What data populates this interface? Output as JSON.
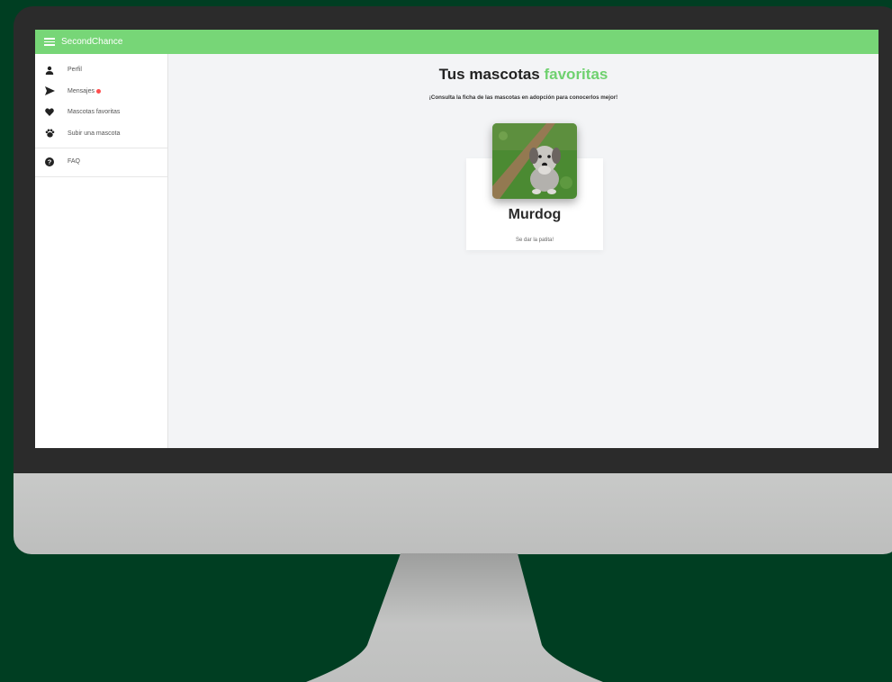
{
  "app": {
    "title": "SecondChance"
  },
  "sidebar": {
    "items": [
      {
        "label": "Perfil",
        "icon": "user-icon"
      },
      {
        "label": "Mensajes",
        "icon": "send-icon",
        "has_badge": true
      },
      {
        "label": "Mascotas favoritas",
        "icon": "heart-icon"
      },
      {
        "label": "Subir una mascota",
        "icon": "paw-icon"
      }
    ],
    "footer_items": [
      {
        "label": "FAQ",
        "icon": "help-icon"
      }
    ]
  },
  "main": {
    "heading_prefix": "Tus mascotas ",
    "heading_accent": "favoritas",
    "subheading": "¡Consulta la ficha de las mascotas en adopción para conocerlos mejor!",
    "pets": [
      {
        "name": "Murdog",
        "description": "Se dar la patita!"
      }
    ]
  },
  "colors": {
    "topbar": "#77d677",
    "accent": "#6fd16f",
    "background": "#003e22",
    "badge": "#ff4d4d"
  }
}
